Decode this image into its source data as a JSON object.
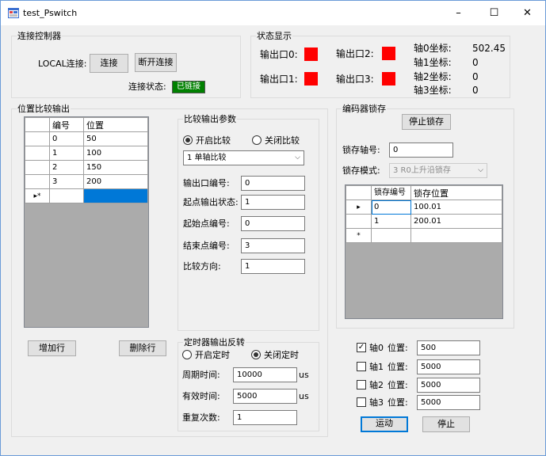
{
  "window": {
    "title": "test_Pswitch",
    "minimize": "–",
    "maximize": "☐",
    "close": "✕"
  },
  "connect": {
    "group_title": "连接控制器",
    "local_label": "LOCAL连接:",
    "connect_btn": "连接",
    "disconnect_btn": "断开连接",
    "status_label": "连接状态:",
    "status_value": "已链接"
  },
  "status": {
    "group_title": "状态显示",
    "out0": "输出口0:",
    "out1": "输出口1:",
    "out2": "输出口2:",
    "out3": "输出口3:",
    "indicator_color": "#ff0000",
    "axis0_label": "轴0坐标:",
    "axis0_value": "502.45",
    "axis1_label": "轴1坐标:",
    "axis1_value": "0",
    "axis2_label": "轴2坐标:",
    "axis2_value": "0",
    "axis3_label": "轴3坐标:",
    "axis3_value": "0"
  },
  "position": {
    "group_title": "位置比较输出",
    "col_id": "编号",
    "col_pos": "位置",
    "rows": [
      {
        "id": "0",
        "pos": "50"
      },
      {
        "id": "1",
        "pos": "100"
      },
      {
        "id": "2",
        "pos": "150"
      },
      {
        "id": "3",
        "pos": "200"
      }
    ],
    "new_row_marker": "▸*",
    "add_btn": "增加行",
    "del_btn": "删除行"
  },
  "compare": {
    "group_title": "比较输出参数",
    "enable": "开启比较",
    "disable": "关闭比较",
    "mode": "1 单轴比较",
    "out_no_label": "输出口编号:",
    "out_no": "0",
    "start_state_label": "起点输出状态:",
    "start_state": "1",
    "start_point_label": "起始点编号:",
    "start_point": "0",
    "end_point_label": "结束点编号:",
    "end_point": "3",
    "direction_label": "比较方向:",
    "direction": "1"
  },
  "timer": {
    "group_title": "定时器输出反转",
    "enable": "开启定时",
    "disable": "关闭定时",
    "period_label": "周期时间:",
    "period": "10000",
    "period_unit": "us",
    "valid_label": "有效时间:",
    "valid": "5000",
    "valid_unit": "us",
    "repeat_label": "重复次数:",
    "repeat": "1"
  },
  "latch": {
    "group_title": "编码器锁存",
    "stop_btn": "停止锁存",
    "axis_label": "锁存轴号:",
    "axis": "0",
    "mode_label": "锁存模式:",
    "mode": "3 R0上升沿锁存",
    "col_id": "锁存编号",
    "col_pos": "锁存位置",
    "rows": [
      {
        "marker": "▸",
        "id": "0",
        "pos": "100.01"
      },
      {
        "marker": "",
        "id": "1",
        "pos": "200.01"
      }
    ],
    "new_row_marker": "*"
  },
  "motion": {
    "axis0": "轴0",
    "axis1": "轴1",
    "axis2": "轴2",
    "axis3": "轴3",
    "pos_label": "位置:",
    "pos0": "500",
    "pos1": "5000",
    "pos2": "5000",
    "pos3": "5000",
    "check0": "✓",
    "run_btn": "运动",
    "stop_btn": "停止"
  }
}
